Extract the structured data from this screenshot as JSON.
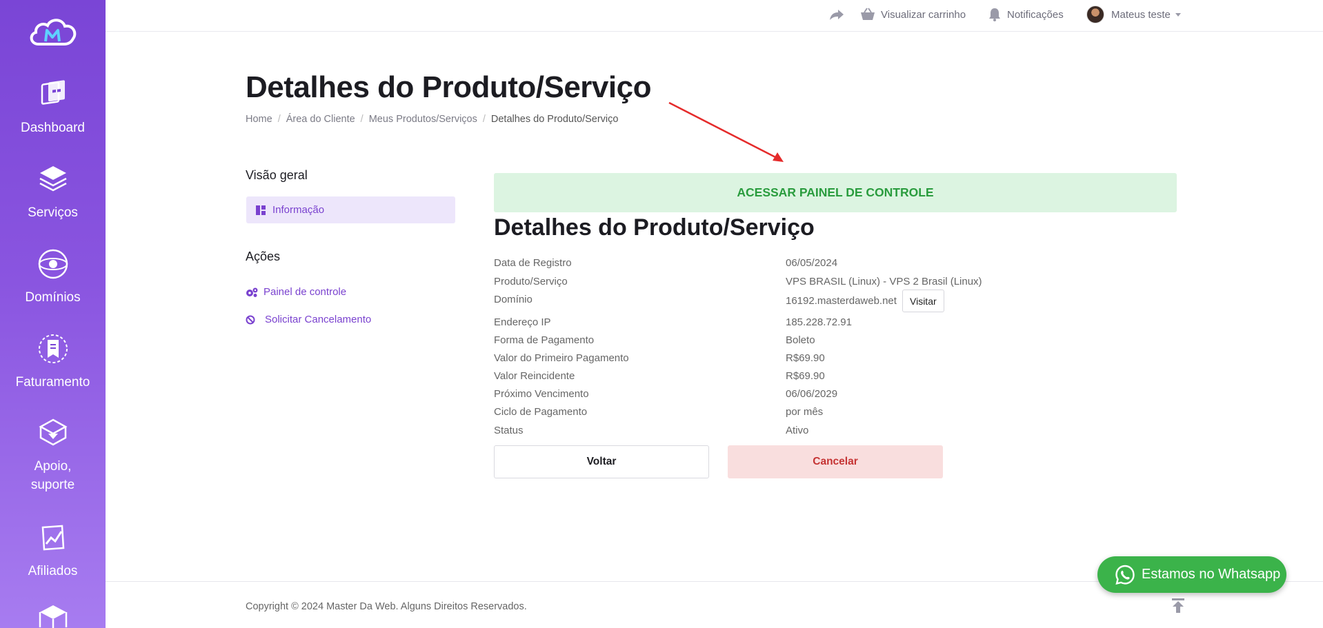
{
  "sidebar": {
    "items": [
      {
        "label": "Dashboard",
        "icon": "dashboard-icon"
      },
      {
        "label": "Serviços",
        "icon": "services-icon"
      },
      {
        "label": "Domínios",
        "icon": "domains-icon"
      },
      {
        "label": "Faturamento",
        "icon": "billing-icon"
      },
      {
        "label": "Apoio, suporte",
        "icon": "support-icon"
      },
      {
        "label": "Afiliados",
        "icon": "affiliates-icon"
      }
    ]
  },
  "topbar": {
    "cart_label": "Visualizar carrinho",
    "notifications_label": "Notificações",
    "user_name": "Mateus teste"
  },
  "page": {
    "title": "Detalhes do Produto/Serviço",
    "breadcrumb": [
      "Home",
      "Área do Cliente",
      "Meus Produtos/Serviços",
      "Detalhes do Produto/Serviço"
    ]
  },
  "left": {
    "overview_title": "Visão geral",
    "info_label": "Informação",
    "actions_title": "Ações",
    "actions": [
      "Painel de controle",
      "Solicitar Cancelamento"
    ]
  },
  "main": {
    "panel_button": "ACESSAR PAINEL DE CONTROLE",
    "details_title": "Detalhes do Produto/Serviço",
    "rows": [
      {
        "label": "Data de Registro",
        "value": "06/05/2024"
      },
      {
        "label": "Produto/Serviço",
        "value": "VPS BRASIL (Linux) - VPS 2 Brasil (Linux)"
      },
      {
        "label": "Domínio",
        "value": "16192.masterdaweb.net"
      },
      {
        "label": "Endereço IP",
        "value": "185.228.72.91"
      },
      {
        "label": "Forma de Pagamento",
        "value": "Boleto"
      },
      {
        "label": "Valor do Primeiro Pagamento",
        "value": "R$69.90"
      },
      {
        "label": "Valor Reincidente",
        "value": "R$69.90"
      },
      {
        "label": "Próximo Vencimento",
        "value": "06/06/2029"
      },
      {
        "label": "Ciclo de Pagamento",
        "value": "por mês"
      },
      {
        "label": "Status",
        "value": "Ativo"
      }
    ],
    "visit_label": "Visitar",
    "back_label": "Voltar",
    "cancel_label": "Cancelar"
  },
  "footer": {
    "copyright": "Copyright © 2024 Master Da Web. Alguns Direitos Reservados.",
    "whatsapp_label": "Estamos no Whatsapp"
  },
  "colors": {
    "sidebar_top": "#7a45d6",
    "sidebar_bottom": "#a77cf0",
    "accent": "#7a42cf",
    "success_bg": "#dcf4e1",
    "success_text": "#2a9c3e",
    "danger_bg": "#f9dede",
    "danger_text": "#c53333",
    "whatsapp": "#3bb34a"
  }
}
